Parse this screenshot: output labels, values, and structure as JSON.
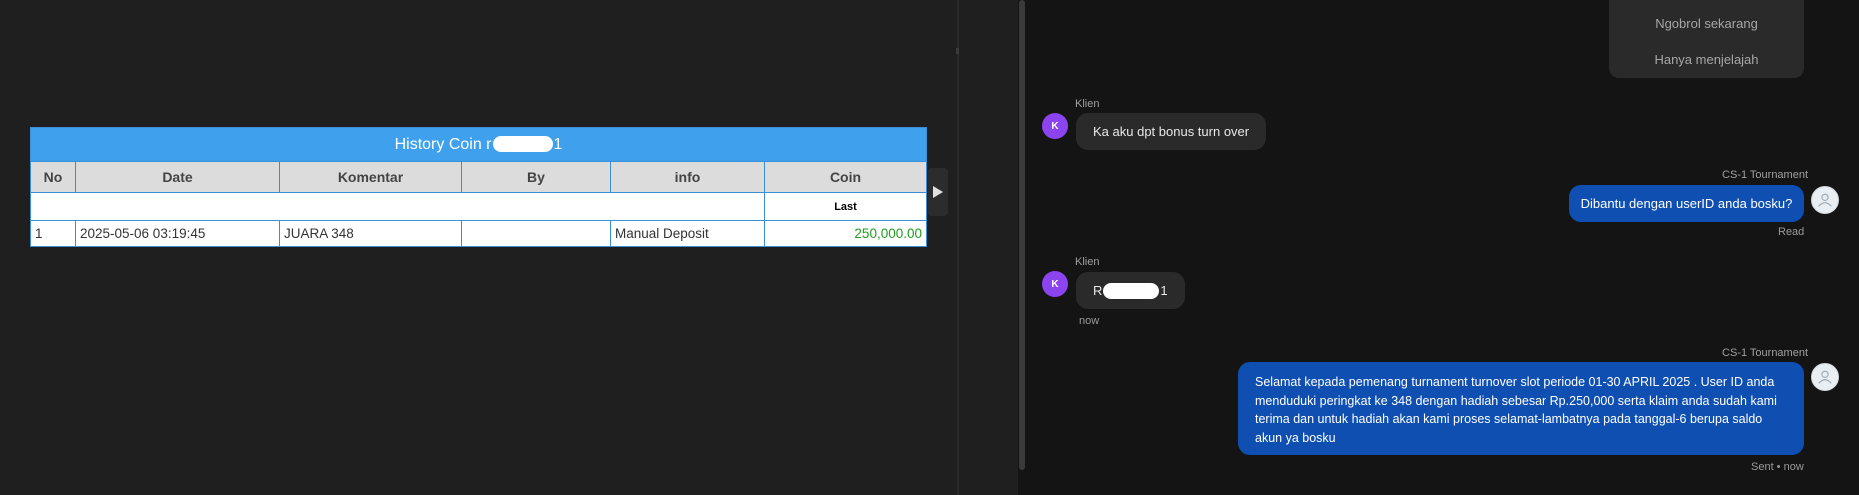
{
  "history": {
    "title_prefix": "History Coin r",
    "title_suffix": "1",
    "columns": [
      "No",
      "Date",
      "Komentar",
      "By",
      "info",
      "Coin"
    ],
    "sub_header": "Last",
    "rows": [
      {
        "no": "1",
        "date": "2025-05-06 03:19:45",
        "komentar": "JUARA 348",
        "by": "",
        "info": "Manual Deposit",
        "coin": "250,000.00"
      }
    ]
  },
  "chat": {
    "options": [
      "Ngobrol sekarang",
      "Hanya menjelajah"
    ],
    "messages": [
      {
        "sender": "Klien",
        "avatar": "K",
        "text": "Ka aku dpt bonus turn over"
      },
      {
        "sender": "CS-1 Tournament",
        "text": "Dibantu dengan userID anda bosku?",
        "status": "Read"
      },
      {
        "sender": "Klien",
        "avatar": "K",
        "text_prefix": "R",
        "text_suffix": "1",
        "time": "now"
      },
      {
        "sender": "CS-1 Tournament",
        "lines": [
          "Selamat kepada pemenang turnament turnover slot periode 01-30 APRIL 2025 . User ID anda",
          "menduduki peringkat ke 348 dengan hadiah sebesar Rp.250,000 serta klaim anda sudah kami",
          "terima dan untuk hadiah akan kami proses selamat-lambatnya pada tanggal-6 berupa saldo",
          "akun ya bosku"
        ],
        "status": "Sent • now"
      }
    ]
  },
  "colors": {
    "table_title_bg": "#3fa1ee",
    "coin_green": "#1e9b1e",
    "outgoing_bubble": "#0f4fb2",
    "incoming_bubble": "#2a2a2a",
    "avatar_purple": "#8b44f0"
  },
  "icons": {
    "collapse": "play-right-icon",
    "agent_avatar": "agent-avatar-icon"
  }
}
